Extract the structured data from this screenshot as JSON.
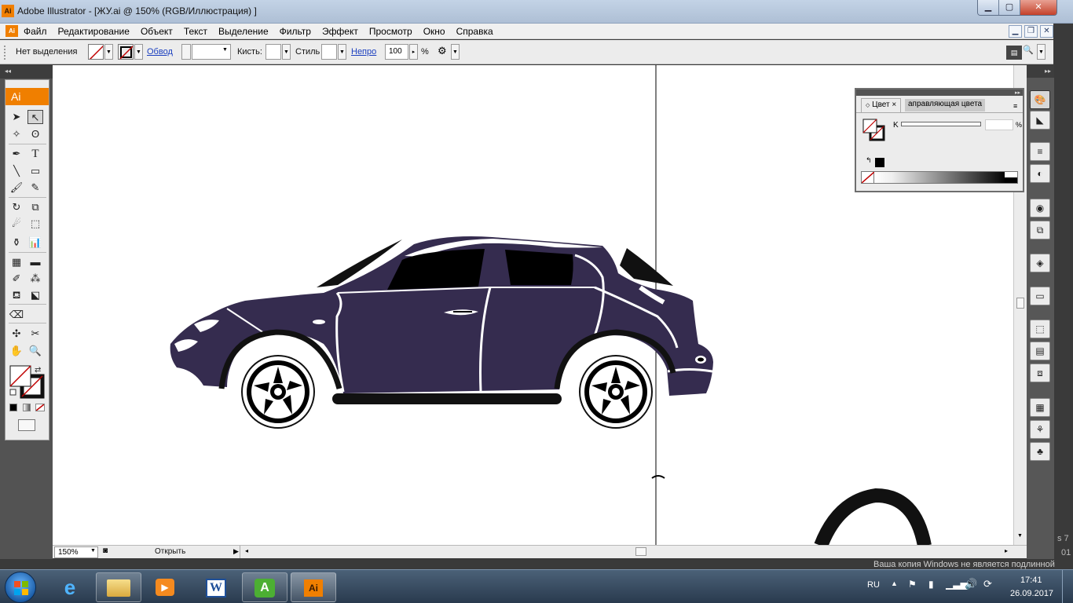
{
  "window": {
    "title": "Adobe Illustrator - [ЖУ.ai @ 150% (RGB/Иллюстрация) ]",
    "app_icon": "Ai",
    "controls": [
      "minimize-icon",
      "maximize-icon",
      "close-icon"
    ]
  },
  "menu": {
    "items": [
      "Файл",
      "Редактирование",
      "Объект",
      "Текст",
      "Выделение",
      "Фильтр",
      "Эффект",
      "Просмотр",
      "Окно",
      "Справка"
    ]
  },
  "control_bar": {
    "selection_label": "Нет выделения",
    "stroke_link": "Обвод",
    "brush_label": "Кисть:",
    "style_label": "Стиль",
    "opacity_link": "Непро",
    "opacity_value": "100",
    "percent": "%"
  },
  "tools_panel": {
    "logo": "Ai",
    "tools": [
      "selection-tool",
      "direct-selection-tool",
      "magic-wand-tool",
      "lasso-tool",
      "pen-tool",
      "type-tool",
      "line-tool",
      "rectangle-tool",
      "paintbrush-tool",
      "pencil-tool",
      "rotate-tool",
      "scale-tool",
      "warp-tool",
      "free-transform-tool",
      "symbol-sprayer-tool",
      "column-graph-tool",
      "mesh-tool",
      "gradient-tool",
      "eyedropper-tool",
      "blend-tool",
      "live-paint-bucket-tool",
      "live-paint-selection-tool",
      "eraser-tool",
      "slice-tool",
      "scissors-tool",
      "hand-tool",
      "zoom-tool"
    ]
  },
  "color_panel": {
    "tab_active": "Цвет",
    "tab_close": "×",
    "tab_inactive": "аправляющая цвета",
    "channel_label": "K",
    "channel_percent": "%"
  },
  "status_bar": {
    "zoom": "150%",
    "action": "Открыть"
  },
  "taskbar": {
    "apps": [
      "windows-start-icon",
      "internet-explorer-icon",
      "file-explorer-icon",
      "media-player-icon",
      "word-icon",
      "app-a-icon",
      "illustrator-icon"
    ],
    "language": "RU",
    "time": "17:41",
    "date": "26.09.2017",
    "watermark": "Ваша копия Windows не является подлинной",
    "watermark_side": [
      "s 7",
      "01"
    ]
  },
  "colors": {
    "car_body": "#352c4f",
    "ai_orange": "#f07f00",
    "panel_bg": "#ececec",
    "dark_ui": "#535353"
  }
}
